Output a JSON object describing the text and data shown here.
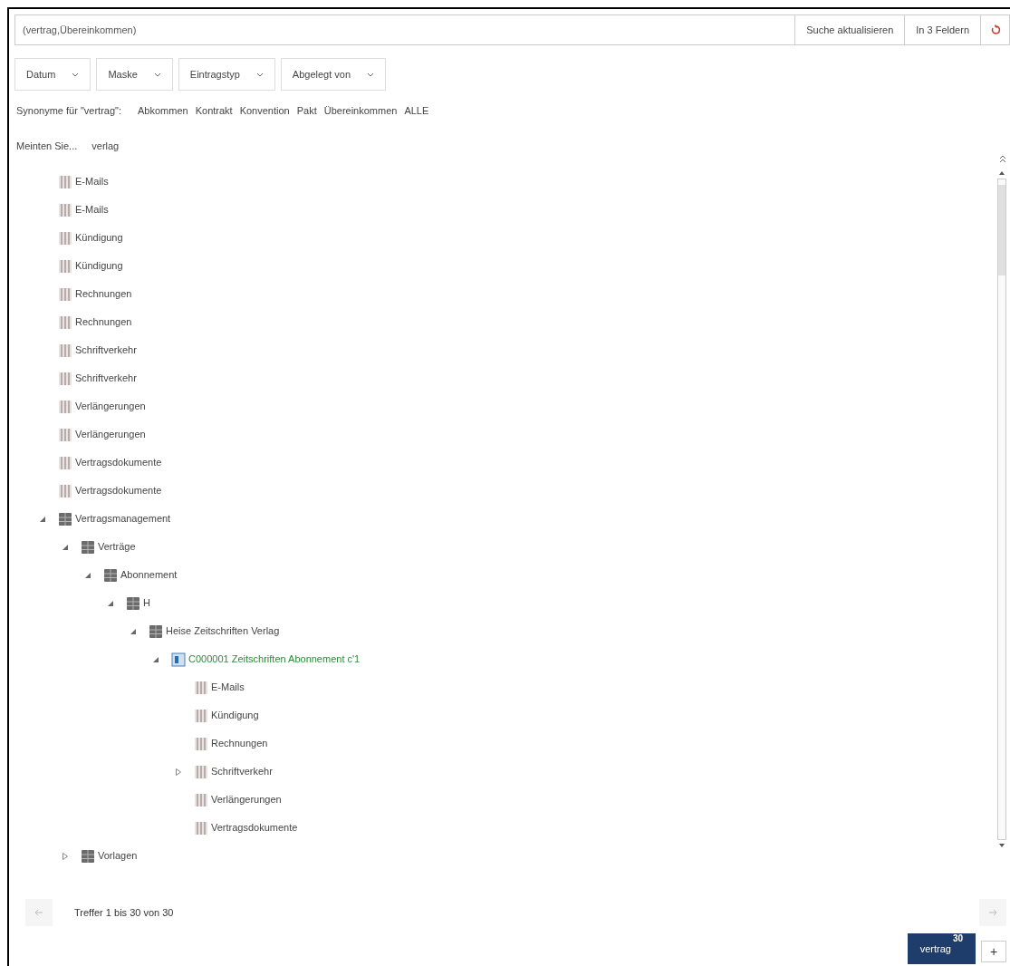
{
  "search": {
    "value": "(vertrag,Übereinkommen)",
    "buttons": [
      "Suche aktualisieren",
      "In 3 Feldern"
    ]
  },
  "filters": [
    "Datum",
    "Maske",
    "Eintragstyp",
    "Abgelegt von"
  ],
  "synonyms": {
    "label": "Synonyme für \"vertrag\":",
    "items": [
      "Abkommen",
      "Kontrakt",
      "Konvention",
      "Pakt",
      "Übereinkommen",
      "ALLE"
    ]
  },
  "suggestion": {
    "label": "Meinten Sie...",
    "term": "verlag"
  },
  "tree": [
    {
      "label": "E-Mails",
      "kind": "folder"
    },
    {
      "label": "E-Mails",
      "kind": "folder"
    },
    {
      "label": "Kündigung",
      "kind": "folder"
    },
    {
      "label": "Kündigung",
      "kind": "folder"
    },
    {
      "label": "Rechnungen",
      "kind": "folder"
    },
    {
      "label": "Rechnungen",
      "kind": "folder"
    },
    {
      "label": "Schriftverkehr",
      "kind": "folder"
    },
    {
      "label": "Schriftverkehr",
      "kind": "folder"
    },
    {
      "label": "Verlängerungen",
      "kind": "folder"
    },
    {
      "label": "Verlängerungen",
      "kind": "folder"
    },
    {
      "label": "Vertragsdokumente",
      "kind": "folder"
    },
    {
      "label": "Vertragsdokumente",
      "kind": "folder"
    },
    {
      "label": "Vertragsmanagement",
      "kind": "cabinet",
      "expanded": true,
      "children": [
        {
          "label": "Verträge",
          "kind": "cabinet",
          "expanded": true,
          "children": [
            {
              "label": "Abonnement",
              "kind": "cabinet",
              "expanded": true,
              "children": [
                {
                  "label": "H",
                  "kind": "cabinet",
                  "expanded": true,
                  "children": [
                    {
                      "label": "Heise Zeitschriften Verlag",
                      "kind": "cabinet",
                      "expanded": true,
                      "children": [
                        {
                          "label": "C000001 Zeitschriften Abonnement c'1",
                          "kind": "record",
                          "expanded": true,
                          "children": [
                            {
                              "label": "E-Mails",
                              "kind": "folder"
                            },
                            {
                              "label": "Kündigung",
                              "kind": "folder"
                            },
                            {
                              "label": "Rechnungen",
                              "kind": "folder"
                            },
                            {
                              "label": "Schriftverkehr",
                              "kind": "folder",
                              "expanded": false
                            },
                            {
                              "label": "Verlängerungen",
                              "kind": "folder"
                            },
                            {
                              "label": "Vertragsdokumente",
                              "kind": "folder"
                            }
                          ]
                        }
                      ]
                    }
                  ]
                }
              ]
            }
          ]
        },
        {
          "label": "Vorlagen",
          "kind": "cabinet",
          "expanded": false
        }
      ]
    }
  ],
  "paging": "Treffer 1 bis 30 von 30",
  "term_badge": {
    "term": "vertrag",
    "count": "30"
  },
  "add_button": "+"
}
